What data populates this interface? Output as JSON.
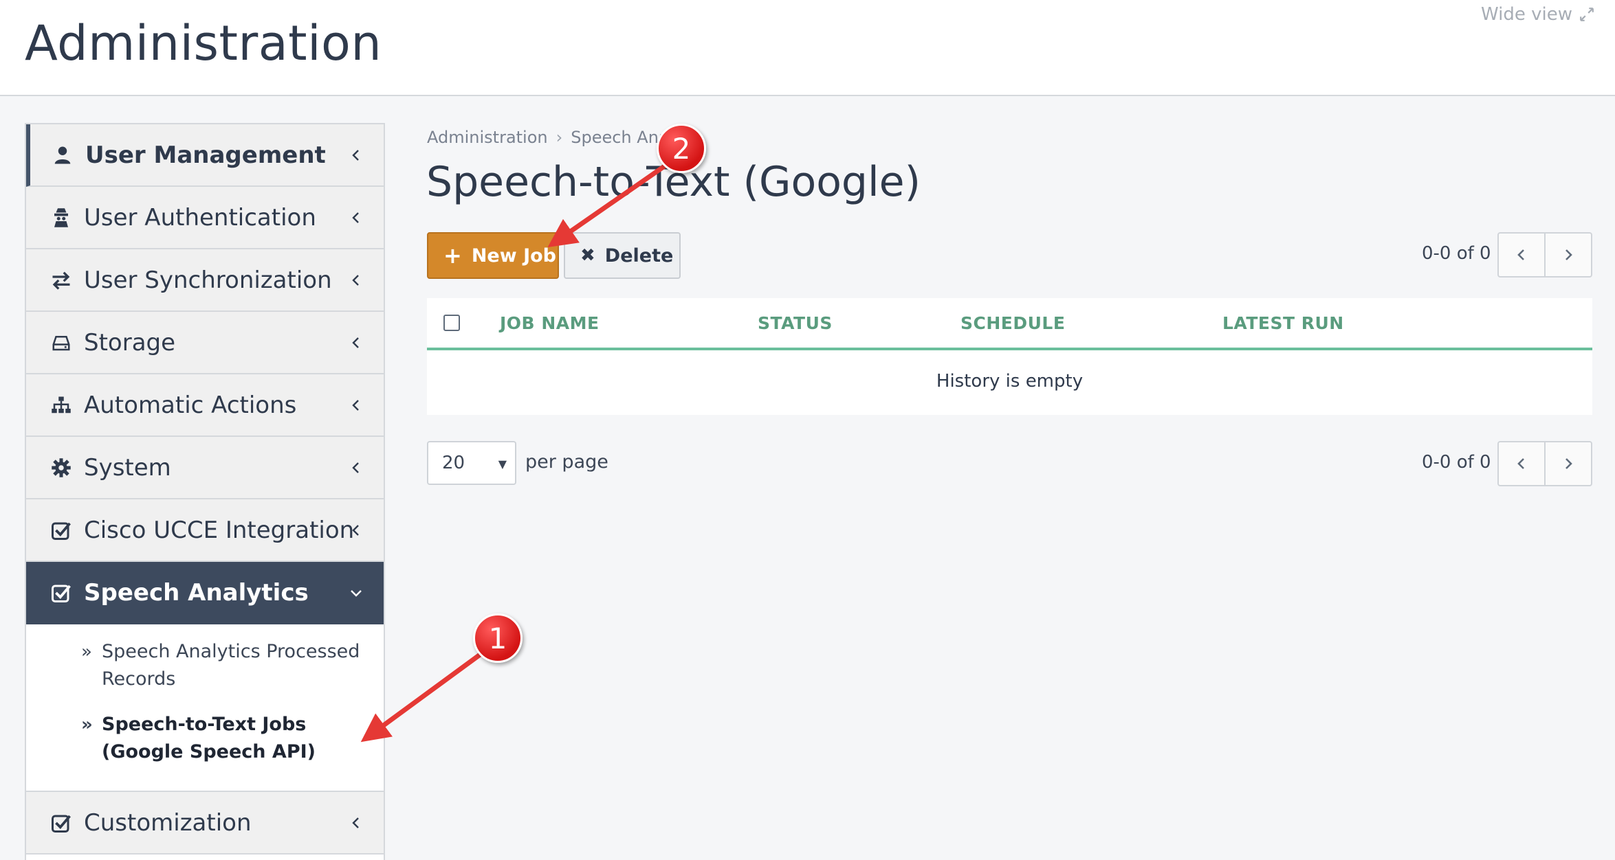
{
  "header": {
    "title": "Administration",
    "wide_view_label": "Wide view"
  },
  "sidebar": {
    "items": [
      {
        "label": "User Management",
        "icon": "user-icon"
      },
      {
        "label": "User Authentication",
        "icon": "user-secret-icon"
      },
      {
        "label": "User Synchronization",
        "icon": "exchange-icon"
      },
      {
        "label": "Storage",
        "icon": "hdd-icon"
      },
      {
        "label": "Automatic Actions",
        "icon": "sitemap-icon"
      },
      {
        "label": "System",
        "icon": "gear-icon"
      },
      {
        "label": "Cisco UCCE Integration",
        "icon": "checkbox-icon"
      },
      {
        "label": "Speech Analytics",
        "icon": "checkbox-icon",
        "expanded": true
      },
      {
        "label": "Customization",
        "icon": "checkbox-icon"
      }
    ],
    "sub_items": [
      {
        "label": "Speech Analytics Processed Records"
      },
      {
        "label": "Speech-to-Text Jobs (Google Speech API)",
        "selected": true
      }
    ]
  },
  "breadcrumb": {
    "root": "Administration",
    "current": "Speech Analy"
  },
  "page_title": "Speech-to-Text (Google)",
  "toolbar": {
    "new_job_label": "New Job",
    "delete_label": "Delete"
  },
  "pagination": {
    "range_text": "0-0 of 0"
  },
  "table": {
    "columns": [
      "JOB NAME",
      "STATUS",
      "SCHEDULE",
      "LATEST RUN"
    ],
    "empty_text": "History is empty"
  },
  "per_page": {
    "value": "20",
    "label": "per page"
  },
  "annotations": {
    "callout_1": "1",
    "callout_2": "2",
    "color": "#e02020"
  },
  "colors": {
    "accent_orange": "#d4882a",
    "sidebar_active": "#3d4a5e",
    "table_header_text": "#5a9c7e",
    "table_header_border": "#6bbf9c"
  }
}
